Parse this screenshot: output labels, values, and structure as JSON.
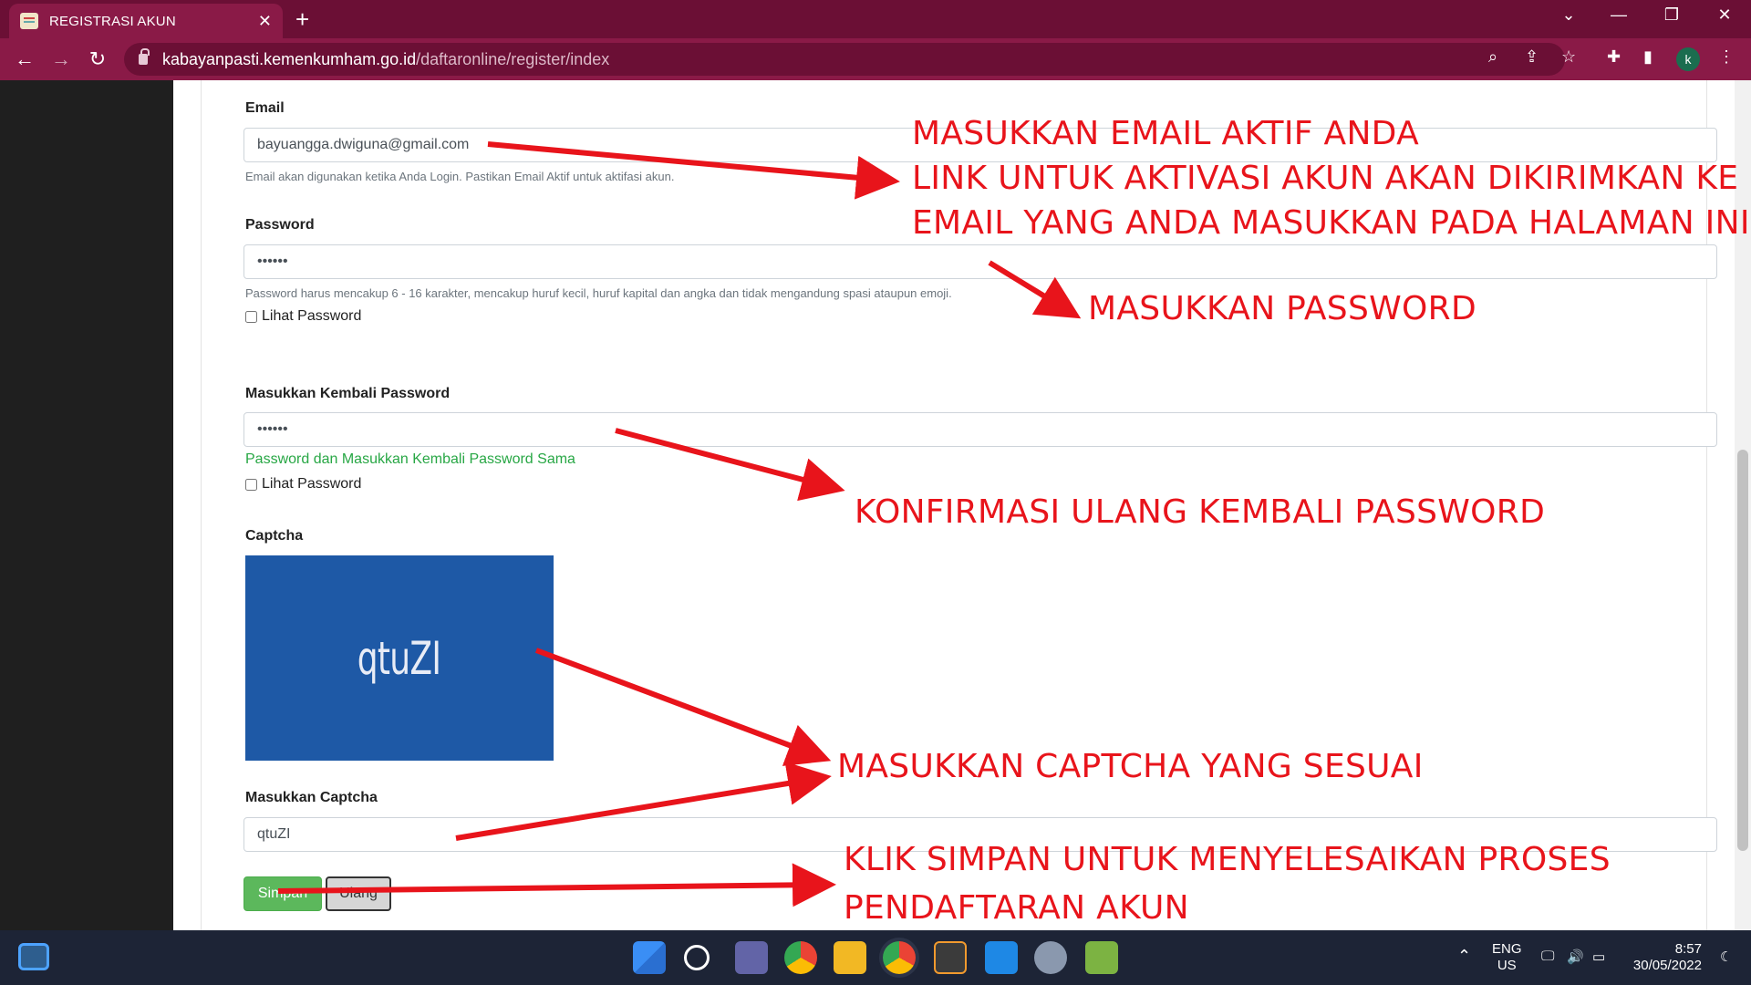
{
  "browser": {
    "tab_title": "REGISTRASI AKUN",
    "tab_close": "✕",
    "new_tab": "+",
    "url_host": "kabayanpasti.kemenkumham.go.id",
    "url_path": "/daftaronline/register/index",
    "profile_initial": "k"
  },
  "form": {
    "email_label": "Email",
    "email_value": "bayuangga.dwiguna@gmail.com",
    "email_help": "Email akan digunakan ketika Anda Login. Pastikan Email Aktif untuk aktifasi akun.",
    "password_label": "Password",
    "password_value": "••••••",
    "password_help": "Password harus mencakup 6 - 16 karakter, mencakup huruf kecil, huruf kapital dan angka dan tidak mengandung spasi ataupun emoji.",
    "show_password_label": "Lihat Password",
    "confirm_label": "Masukkan Kembali Password",
    "confirm_value": "••••••",
    "confirm_valid": "Password dan Masukkan Kembali Password Sama",
    "captcha_label": "Captcha",
    "captcha_text": "qtuZI",
    "captcha_input_label": "Masukkan Captcha",
    "captcha_input_value": "qtuZI",
    "save_button": "Simpan",
    "reset_button": "Ulang"
  },
  "annotations": {
    "email_1": "MASUKKAN EMAIL AKTIF ANDA",
    "email_2": "LINK UNTUK AKTIVASI AKUN AKAN DIKIRIMKAN KE",
    "email_3": "EMAIL YANG ANDA MASUKKAN PADA HALAMAN INI",
    "password": "MASUKKAN PASSWORD",
    "confirm": "KONFIRMASI ULANG KEMBALI PASSWORD",
    "captcha": "MASUKKAN CAPTCHA YANG SESUAI",
    "save_1": "KLIK SIMPAN UNTUK MENYELESAIKAN PROSES",
    "save_2": "PENDAFTARAN AKUN",
    "color": "#e8141b"
  },
  "taskbar": {
    "lang_1": "ENG",
    "lang_2": "US",
    "time": "8:57",
    "date": "30/05/2022"
  }
}
